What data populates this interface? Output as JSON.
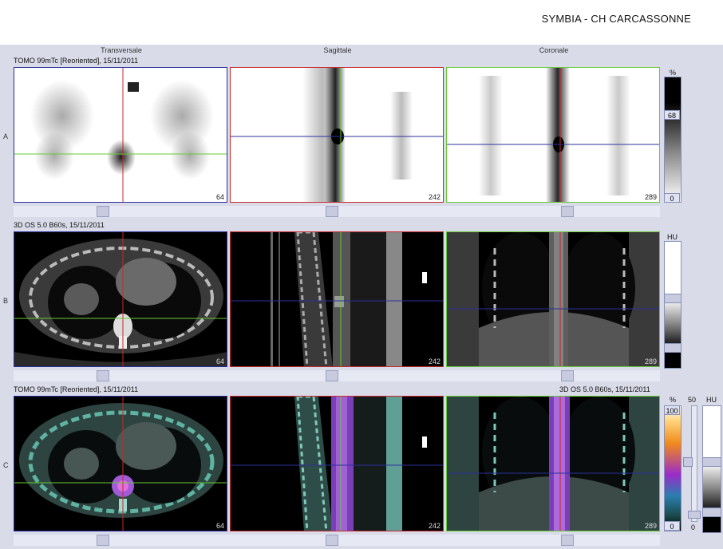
{
  "header": {
    "title": "SYMBIA - CH CARCASSONNE"
  },
  "columns": {
    "transverse": "Transversale",
    "sagittal": "Sagittale",
    "coronal": "Coronale"
  },
  "rows": {
    "a": {
      "label": "A",
      "series": "TOMO 99mTc [Reoriented], 15/11/2011",
      "scale_unit": "%",
      "scale_max": "68",
      "scale_min": "0"
    },
    "b": {
      "label": "B",
      "series": "3D  OS  5.0  B60s, 15/11/2011",
      "scale_unit": "HU"
    },
    "c": {
      "label": "C",
      "series_left": "TOMO 99mTc [Reoriented], 15/11/2011",
      "series_right": "3D  OS  5.0  B60s, 15/11/2011",
      "scale_unit": "%",
      "scale_max": "100",
      "scale_min": "0",
      "window_value": "50",
      "window_min": "0",
      "hu_unit": "HU"
    }
  },
  "slices": {
    "transverse": "64",
    "sagittal": "242",
    "coronal": "289"
  },
  "colors": {
    "transverse_border": "#2b2f9e",
    "sagittal_border": "#c8282a",
    "coronal_border": "#66cc33",
    "workspace": "#d9dbe9"
  }
}
